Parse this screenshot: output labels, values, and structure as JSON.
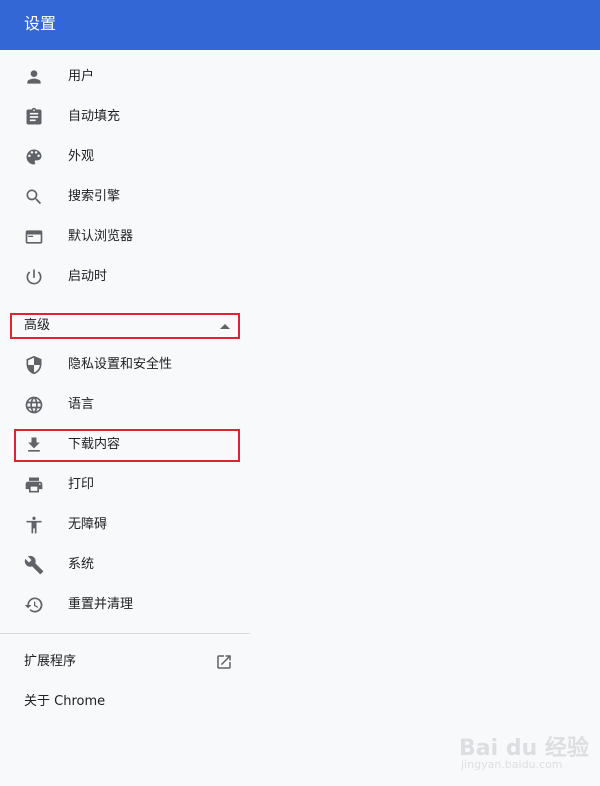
{
  "header": {
    "title": "设置"
  },
  "menu": {
    "basic": [
      {
        "label": "用户",
        "icon": "person-icon"
      },
      {
        "label": "自动填充",
        "icon": "clipboard-icon"
      },
      {
        "label": "外观",
        "icon": "palette-icon"
      },
      {
        "label": "搜索引擎",
        "icon": "search-icon"
      },
      {
        "label": "默认浏览器",
        "icon": "browser-window-icon"
      },
      {
        "label": "启动时",
        "icon": "power-icon"
      }
    ],
    "advanced_label": "高级",
    "advanced": [
      {
        "label": "隐私设置和安全性",
        "icon": "shield-icon"
      },
      {
        "label": "语言",
        "icon": "globe-icon"
      },
      {
        "label": "下载内容",
        "icon": "download-icon"
      },
      {
        "label": "打印",
        "icon": "printer-icon"
      },
      {
        "label": "无障碍",
        "icon": "accessibility-icon"
      },
      {
        "label": "系统",
        "icon": "wrench-icon"
      },
      {
        "label": "重置并清理",
        "icon": "history-icon"
      }
    ],
    "extensions_label": "扩展程序",
    "about_label": "关于 Chrome"
  },
  "watermark": {
    "main": "Bai du 经验",
    "sub": "jingyan.baidu.com"
  },
  "colors": {
    "header_bg": "#3367d6",
    "page_bg": "#f8f9fa",
    "icon": "#5f6368",
    "highlight": "#e0242f"
  }
}
